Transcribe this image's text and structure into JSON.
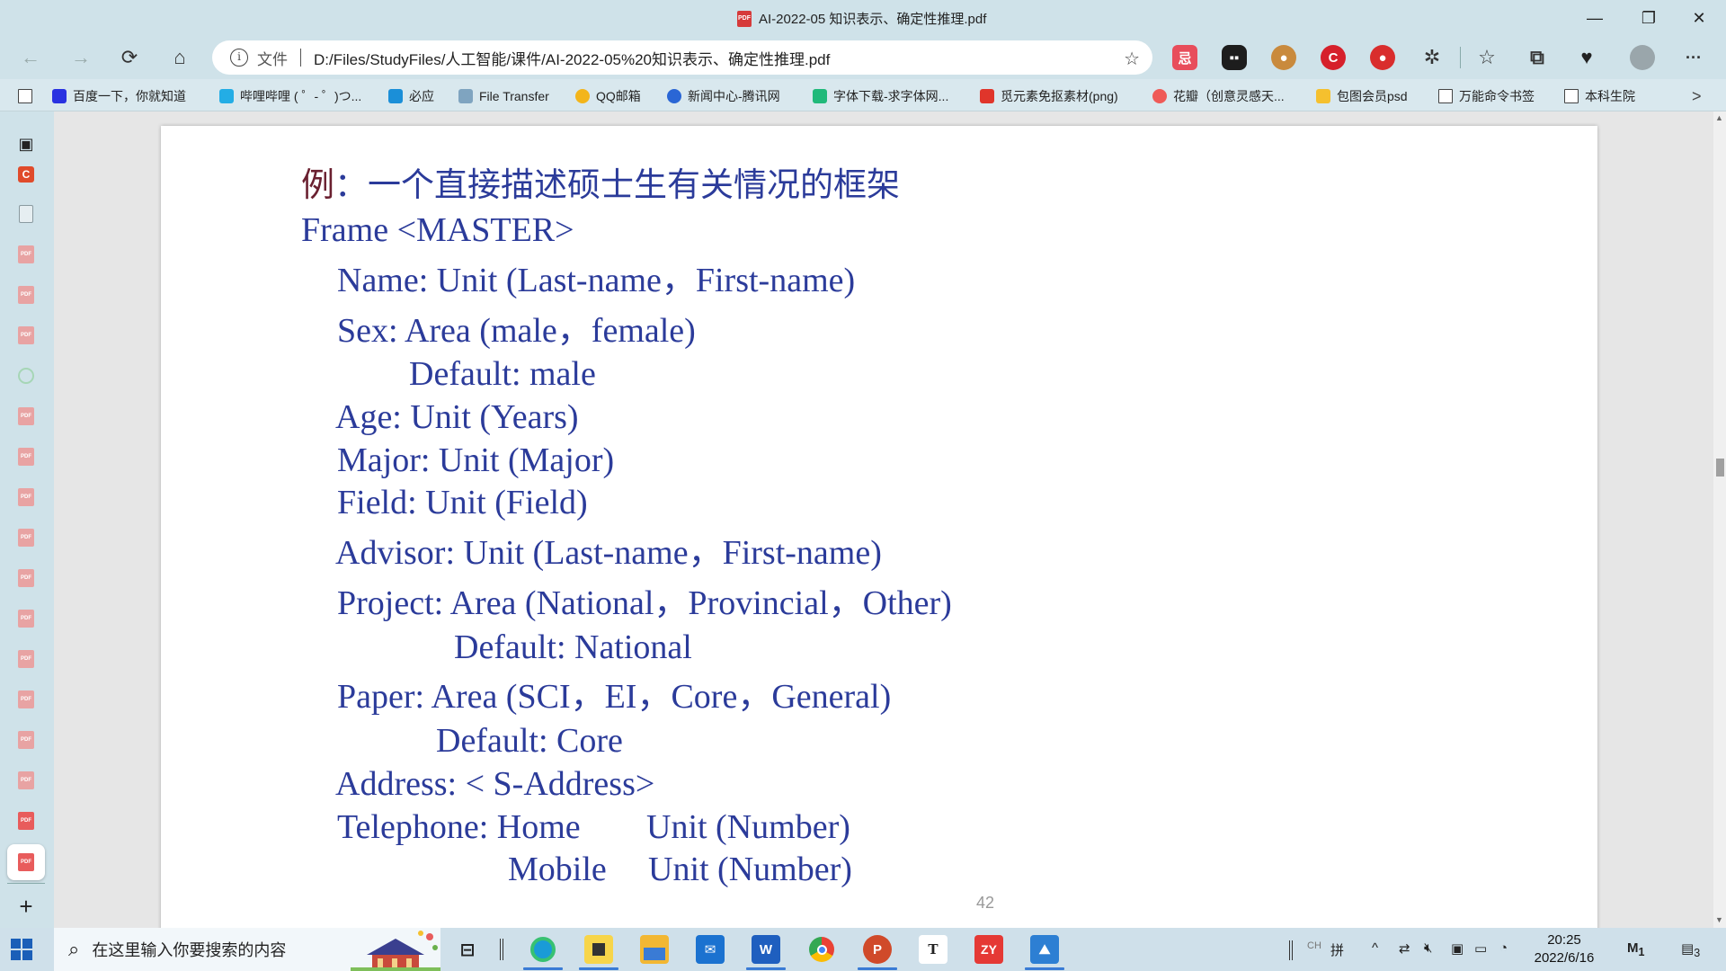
{
  "window": {
    "title": "AI-2022-05 知识表示、确定性推理.pdf",
    "pdf_badge": "PDF",
    "minimize": "—",
    "restore": "❐",
    "close": "✕"
  },
  "toolbar": {
    "back": "←",
    "forward": "→",
    "reload": "⟳",
    "home": "⌂",
    "info": "i",
    "scheme": "文件",
    "url": "D:/Files/StudyFiles/人工智能/课件/AI-2022-05%20知识表示、确定性推理.pdf",
    "add_favorite": "☆",
    "favorites": "☆",
    "collections": "⧉",
    "health": "♥",
    "more": "···",
    "extension_icons": [
      "red-ext-icon",
      "dark-ext-icon",
      "monkey-ext-icon",
      "red-c-ext-icon",
      "ball-ext-icon",
      "puzzle-icon"
    ]
  },
  "bookmarks": [
    {
      "label": "百度一下，你就知道",
      "color": "#2932e1"
    },
    {
      "label": "哔哩哔哩 ( ゜- ゜)つ...",
      "color": "#23ade5"
    },
    {
      "label": "必应",
      "color": "#1b8fd8"
    },
    {
      "label": "File Transfer",
      "color": "#7fa4c0"
    },
    {
      "label": "QQ邮箱",
      "color": "#f3b51b"
    },
    {
      "label": "新闻中心-腾讯网",
      "color": "#2a66d5"
    },
    {
      "label": "字体下载-求字体网...",
      "color": "#20b97a"
    },
    {
      "label": "觅元素免抠素材(png)",
      "color": "#e0352b"
    },
    {
      "label": "花瓣（创意灵感天...",
      "color": "#ef5a57"
    },
    {
      "label": "包图会员psd",
      "color": "#f5c02e"
    },
    {
      "label": "万能命令书签",
      "color": "doc"
    },
    {
      "label": "本科生院",
      "color": "doc"
    }
  ],
  "bookmarks_overflow": ">",
  "vtabs": {
    "tab_actions_icon": "▣",
    "new_tab": "+"
  },
  "pdf": {
    "lines": {
      "heading_prefix": "例",
      "heading_rest": "：一个直接描述硕士生有关情况的框架",
      "frame": "Frame <MASTER>",
      "name": "Name: Unit (Last-name，First-name)",
      "sex": "Sex: Area (male，female)",
      "sex_default": "Default: male",
      "age": "Age: Unit (Years)",
      "major": "Major: Unit (Major)",
      "field": "Field: Unit (Field)",
      "advisor": "Advisor: Unit (Last-name，First-name)",
      "project": "Project: Area (National，Provincial，Other)",
      "project_default": "Default: National",
      "paper": "Paper: Area (SCI，EI，Core，General)",
      "paper_default": "Default: Core",
      "address": "Address: < S-Address>",
      "telephone_label": "Telephone: Home",
      "telephone_home_unit": "Unit (Number)",
      "mobile_label": "Mobile",
      "mobile_unit": "Unit (Number)"
    },
    "page_number": "42"
  },
  "taskbar": {
    "search_placeholder": "在这里输入你要搜索的内容",
    "apps": [
      "task-view-icon",
      "edge-icon",
      "sticky-notes-icon",
      "file-explorer-icon",
      "mail-icon",
      "word-icon",
      "chrome-icon",
      "powerpoint-icon",
      "typora-icon",
      "zy-icon",
      "photos-icon"
    ],
    "app_labels": {
      "typora": "T",
      "zy": "ZY",
      "word": "W",
      "powerpoint": "P"
    },
    "tray": {
      "lang_ch": "CH",
      "ime": "拼",
      "chevron": "^",
      "time": "20:25",
      "date": "2022/6/16",
      "notification_count": "3",
      "badge_count": "1"
    }
  }
}
